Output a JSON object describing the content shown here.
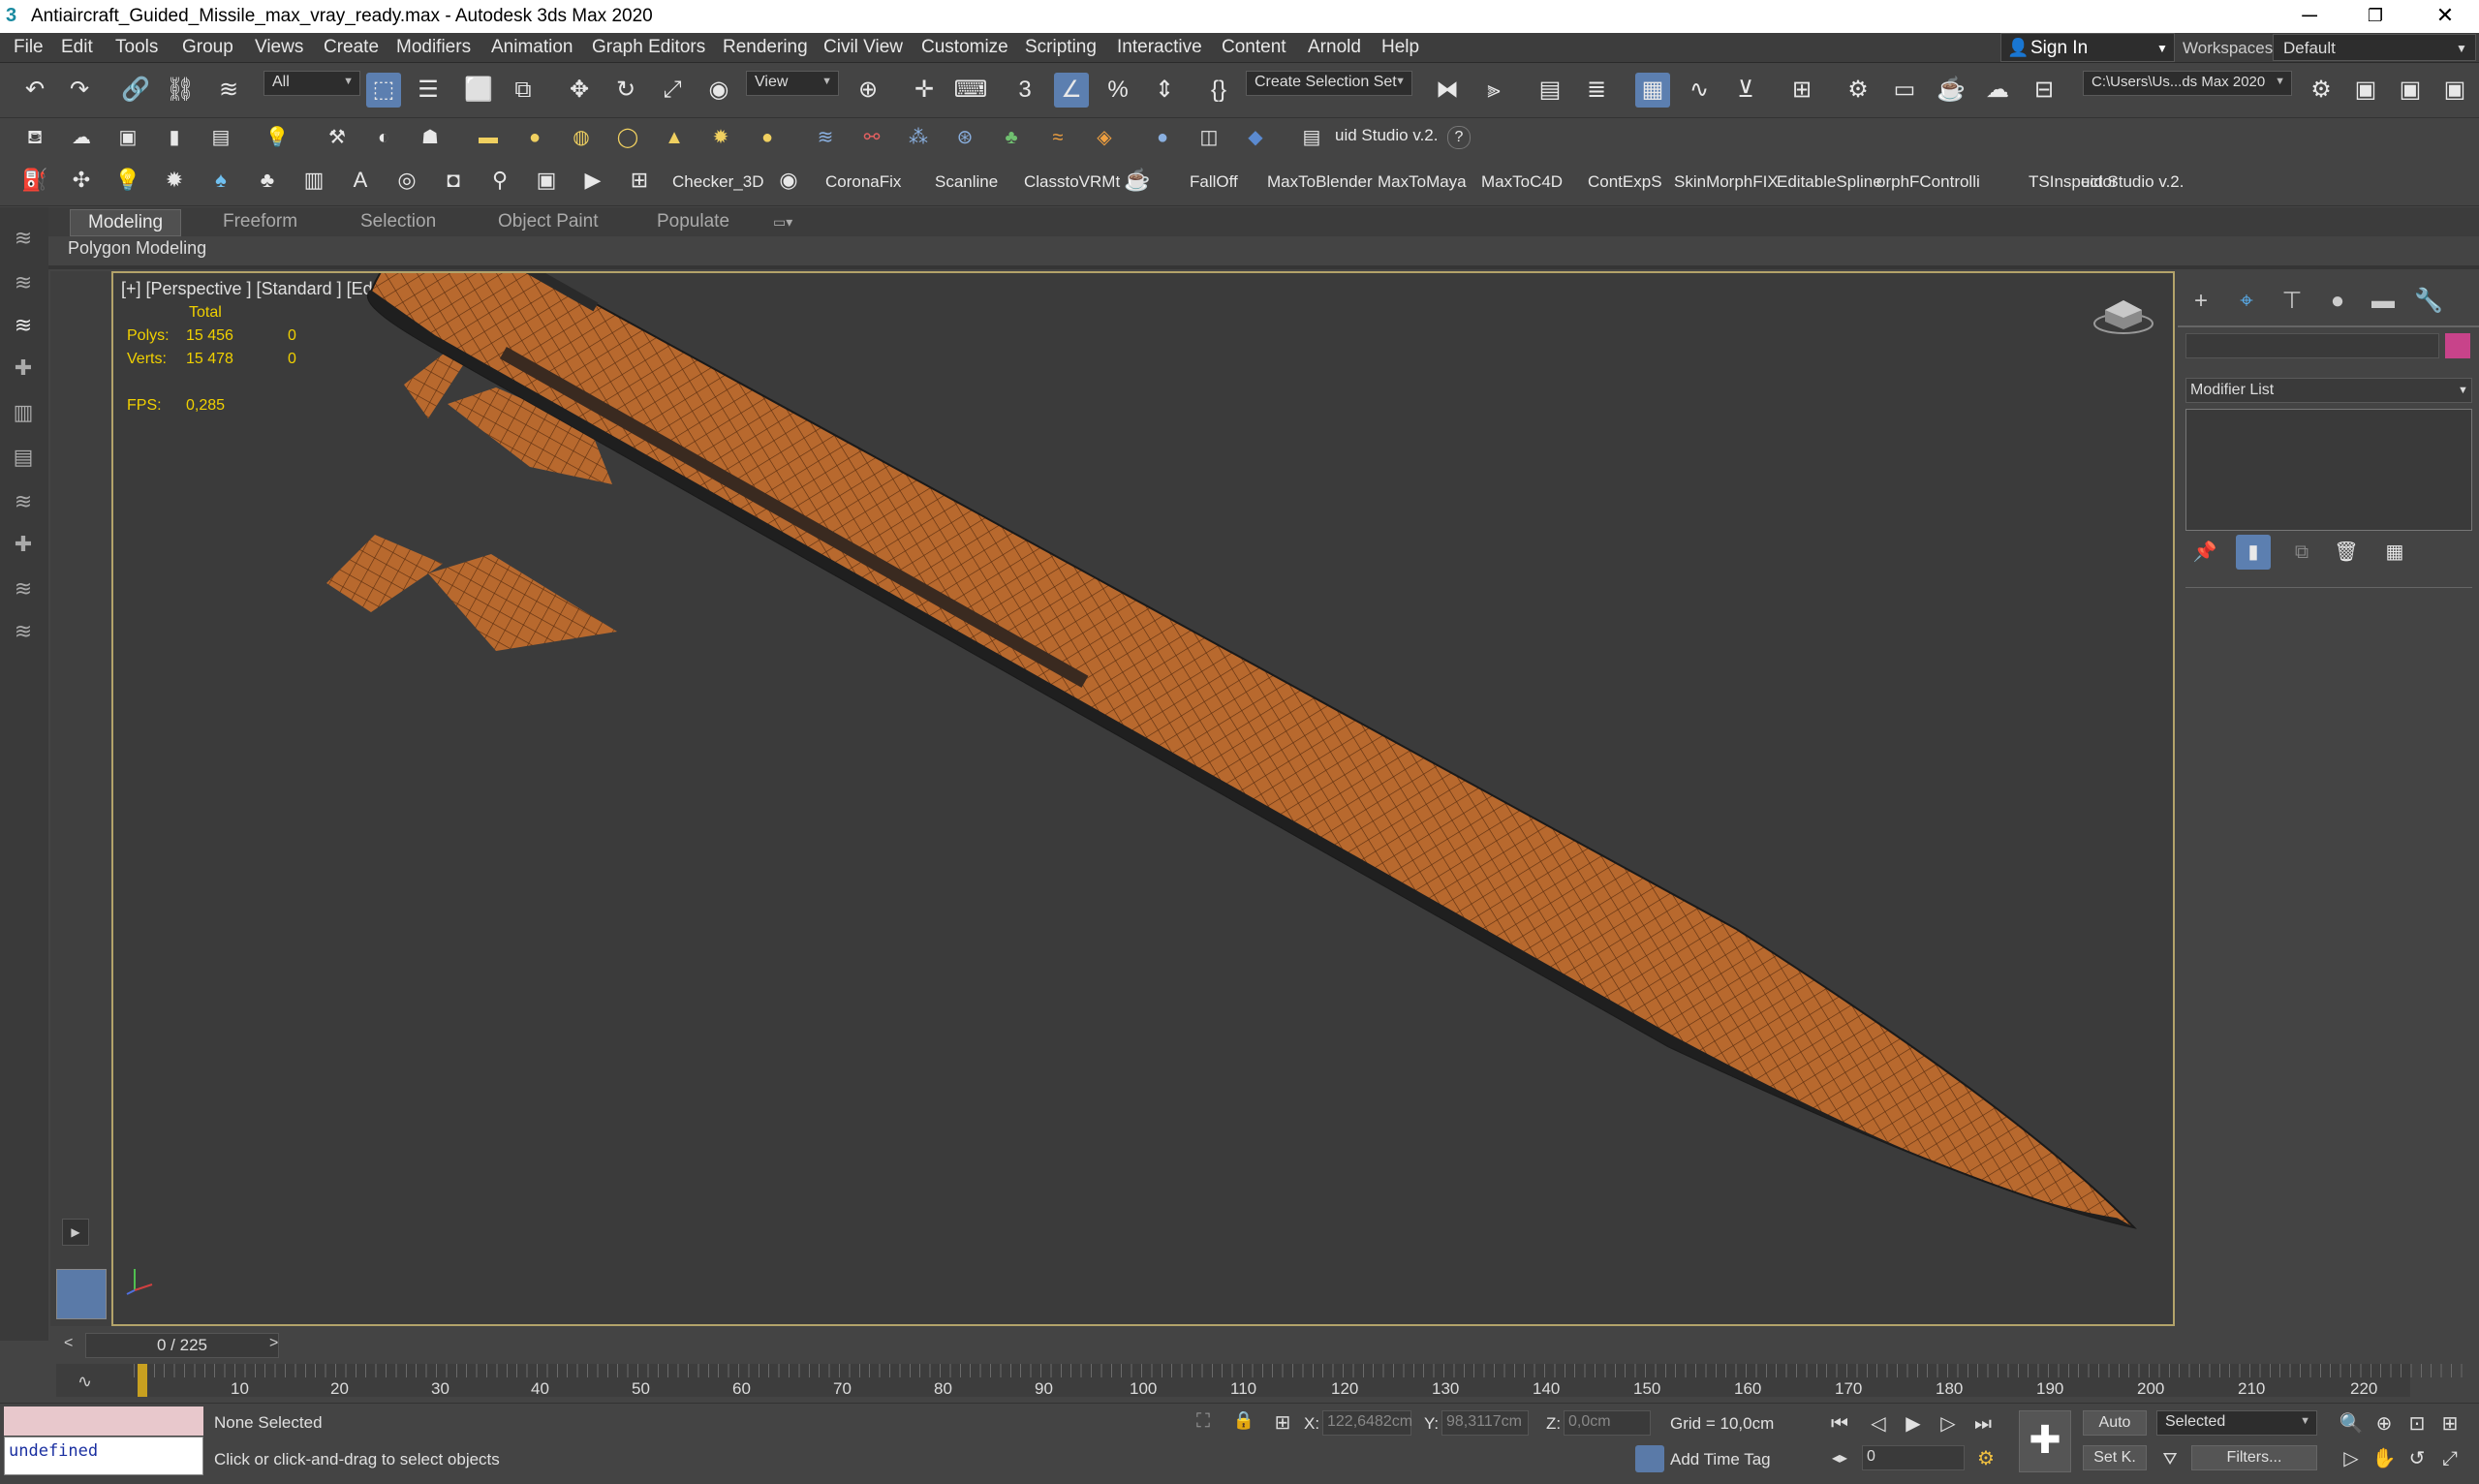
{
  "window": {
    "title": "Antiaircraft_Guided_Missile_max_vray_ready.max - Autodesk 3ds Max 2020",
    "minimize": "─",
    "maximize": "❐",
    "close": "✕"
  },
  "menu": [
    "File",
    "Edit",
    "Tools",
    "Group",
    "Views",
    "Create",
    "Modifiers",
    "Animation",
    "Graph Editors",
    "Rendering",
    "Civil View",
    "Customize",
    "Scripting",
    "Interactive",
    "Content",
    "Arnold",
    "Help"
  ],
  "signin": "Sign In",
  "workspaces": {
    "label": "Workspaces:",
    "value": "Default"
  },
  "main_toolbar": {
    "filter": "All",
    "ref_coord": "View",
    "selection_set": "Create Selection Set",
    "project_path": "C:\\Users\\Us...ds Max 2020"
  },
  "toolbar2": {
    "fluid_studio": "uid Studio v.2.",
    "help": "?"
  },
  "toolbar3": {
    "items": [
      "Checker_3D",
      "CoronaFix",
      "Scanline",
      "ClasstoVRMt",
      "FallOff",
      "MaxToBlender",
      "MaxToMaya",
      "MaxToC4D",
      "ContExpS",
      "SkinMorphFIX",
      "EditableSpline",
      "orphFControlli",
      "TSInspector",
      "uid Studio v.2."
    ]
  },
  "ribbon": {
    "tabs": [
      "Modeling",
      "Freeform",
      "Selection",
      "Object Paint",
      "Populate"
    ],
    "active": "Modeling",
    "panel_label": "Polygon Modeling"
  },
  "viewport": {
    "label": "[+] [Perspective ] [Standard ] [Edged Faces ]",
    "stats": {
      "total_label": "Total",
      "polys_label": "Polys:",
      "polys_total": "15 456",
      "polys_sel": "0",
      "verts_label": "Verts:",
      "verts_total": "15 478",
      "verts_sel": "0",
      "fps_label": "FPS:",
      "fps_value": "0,285"
    },
    "missile_color": "#b8692e"
  },
  "command_panel": {
    "modifier_list": "Modifier List",
    "object_color": "#c8438a"
  },
  "time": {
    "frame_display": "0 / 225",
    "prev": "<",
    "next": ">",
    "ticks": [
      "10",
      "20",
      "30",
      "40",
      "50",
      "60",
      "70",
      "80",
      "90",
      "100",
      "110",
      "120",
      "130",
      "140",
      "150",
      "160",
      "170",
      "180",
      "190",
      "200",
      "210",
      "220"
    ]
  },
  "status": {
    "maxscript_output": "undefined",
    "selection": "None Selected",
    "prompt": "Click or click-and-drag to select objects",
    "x_label": "X:",
    "x_value": "122,6482cm",
    "y_label": "Y:",
    "y_value": "98,3117cm",
    "z_label": "Z:",
    "z_value": "0,0cm",
    "grid": "Grid = 10,0cm",
    "add_time_tag": "Add Time Tag",
    "auto": "Auto",
    "selected": "Selected",
    "set_key": "Set K.",
    "filters": "Filters...",
    "frame": "0"
  }
}
